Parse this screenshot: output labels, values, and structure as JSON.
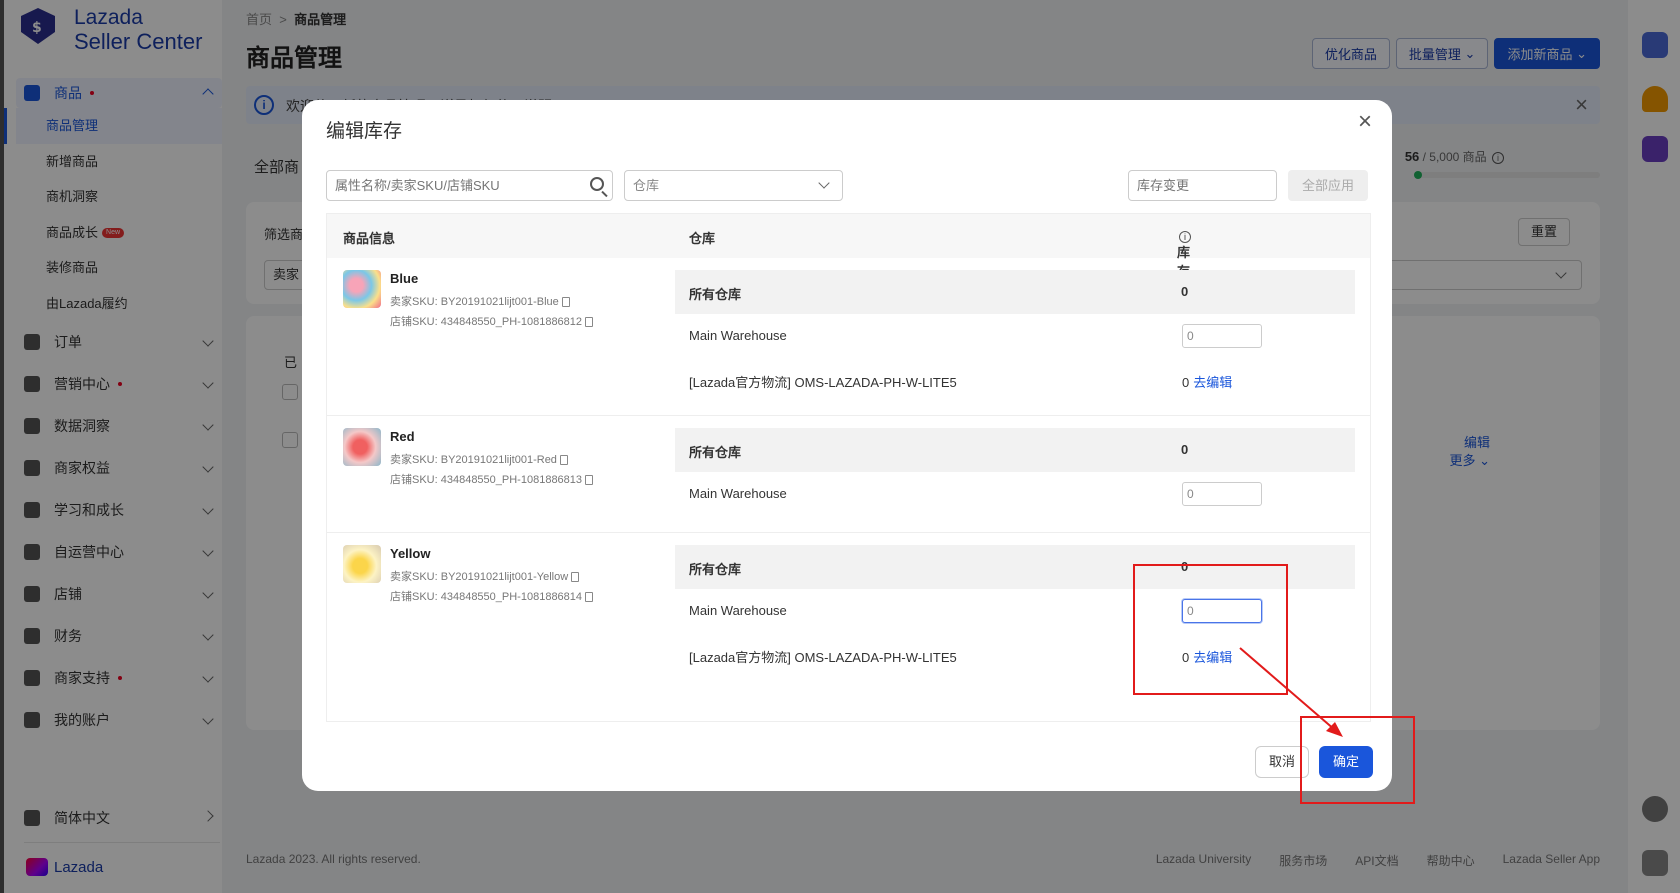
{
  "logo": {
    "line1": "Lazada",
    "line2": "Seller Center"
  },
  "sidebar": {
    "product_head": "商品",
    "sub_items": [
      {
        "label": "商品管理",
        "active": true
      },
      {
        "label": "新增商品"
      },
      {
        "label": "商机洞察"
      },
      {
        "label": "商品成长",
        "badge": "New"
      },
      {
        "label": "装修商品"
      },
      {
        "label": "由Lazada履约"
      }
    ],
    "groups": [
      {
        "label": "订单",
        "dot": false
      },
      {
        "label": "营销中心",
        "dot": true
      },
      {
        "label": "数据洞察",
        "dot": false
      },
      {
        "label": "商家权益",
        "dot": false
      },
      {
        "label": "学习和成长",
        "dot": false
      },
      {
        "label": "自运营中心",
        "dot": false
      },
      {
        "label": "店铺",
        "dot": false
      },
      {
        "label": "财务",
        "dot": false
      },
      {
        "label": "商家支持",
        "dot": true
      },
      {
        "label": "我的账户",
        "dot": false
      }
    ],
    "language": "简体中文",
    "brand": "Lazada"
  },
  "header": {
    "crumb_home": "首页",
    "crumb_current": "商品管理",
    "title": "商品管理",
    "btn_optimize": "优化商品",
    "btn_bulk": "批量管理",
    "btn_add": "添加新商品"
  },
  "banner": {
    "text": "欢迎使用新的商品管理，详见如何使用说明"
  },
  "listing": {
    "tab_all": "全部商",
    "count": "56",
    "count_total": " / 5,000 商品",
    "filter_label": "筛选商",
    "reset": "重置",
    "seller_select": "卖家",
    "selected_prefix": "已",
    "edit_link": "编辑",
    "more_link": "更多"
  },
  "footer": {
    "copyright": "Lazada 2023. All rights reserved.",
    "links": [
      "Lazada University",
      "服务市场",
      "API文档",
      "帮助中心",
      "Lazada Seller App"
    ]
  },
  "modal": {
    "title": "编辑库存",
    "search_placeholder": "属性名称/卖家SKU/店铺SKU",
    "warehouse_placeholder": "仓库",
    "stock_change_placeholder": "库存变更",
    "apply_all": "全部应用",
    "col_product": "商品信息",
    "col_warehouse": "仓库",
    "col_stock": "库存",
    "all_warehouses_label": "所有仓库",
    "products": [
      {
        "name": "Blue",
        "seller_sku": "卖家SKU: BY20191021lijt001-Blue",
        "shop_sku": "店铺SKU: 434848550_PH-1081886812",
        "total": "0",
        "main_warehouse": "Main Warehouse",
        "main_qty": "0",
        "lazada_wh": "[Lazada官方物流] OMS-LAZADA-PH-W-LITE5",
        "lazada_qty": "0",
        "edit_link": "去编辑"
      },
      {
        "name": "Red",
        "seller_sku": "卖家SKU: BY20191021lijt001-Red",
        "shop_sku": "店铺SKU: 434848550_PH-1081886813",
        "total": "0",
        "main_warehouse": "Main Warehouse",
        "main_qty": "0"
      },
      {
        "name": "Yellow",
        "seller_sku": "卖家SKU: BY20191021lijt001-Yellow",
        "shop_sku": "店铺SKU: 434848550_PH-1081886814",
        "total": "0",
        "main_warehouse": "Main Warehouse",
        "main_qty": "0",
        "lazada_wh": "[Lazada官方物流] OMS-LAZADA-PH-W-LITE5",
        "lazada_qty": "0",
        "edit_link": "去编辑"
      }
    ],
    "cancel": "取消",
    "confirm": "确定"
  },
  "colors": {
    "primary": "#1a56db",
    "annotation": "#e21b1b",
    "brand": "#1a3ba8"
  }
}
